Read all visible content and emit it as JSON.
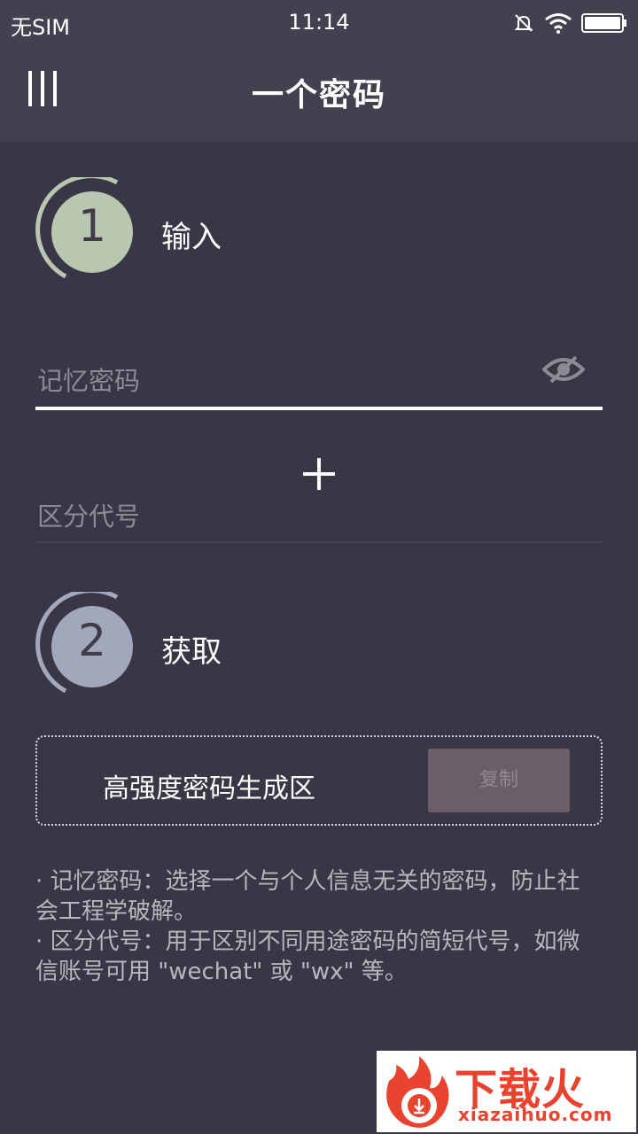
{
  "status_bar": {
    "carrier": "无SIM",
    "time": "11:14",
    "icons": [
      "mute-icon",
      "wifi-icon",
      "battery-icon"
    ]
  },
  "app_bar": {
    "title": "一个密码",
    "menu_icon": "menu-icon"
  },
  "step1": {
    "number": "1",
    "label": "输入",
    "color": "#b9c6b0"
  },
  "input": {
    "memory_password_placeholder": "记忆密码",
    "visibility_icon": "eye-off-icon",
    "add_icon": "plus-icon",
    "code_placeholder": "区分代号"
  },
  "step2": {
    "number": "2",
    "label": "获取",
    "color": "#a3a7bc"
  },
  "output": {
    "placeholder": "高强度密码生成区",
    "copy_label": "复制"
  },
  "notes": {
    "line1": "· 记忆密码：选择一个与个人信息无关的密码，防止社会工程学破解。",
    "line2": "· 区分代号：用于区别不同用途密码的简短代号，如微信账号可用 \"wechat\" 或 \"wx\" 等。"
  },
  "watermark": {
    "title": "下载火",
    "url": "xiazaihuo.com"
  },
  "colors": {
    "background": "#393646",
    "app_bar": "#44404f",
    "copy_button": "#6b5e66",
    "watermark_red": "#e8432e"
  }
}
